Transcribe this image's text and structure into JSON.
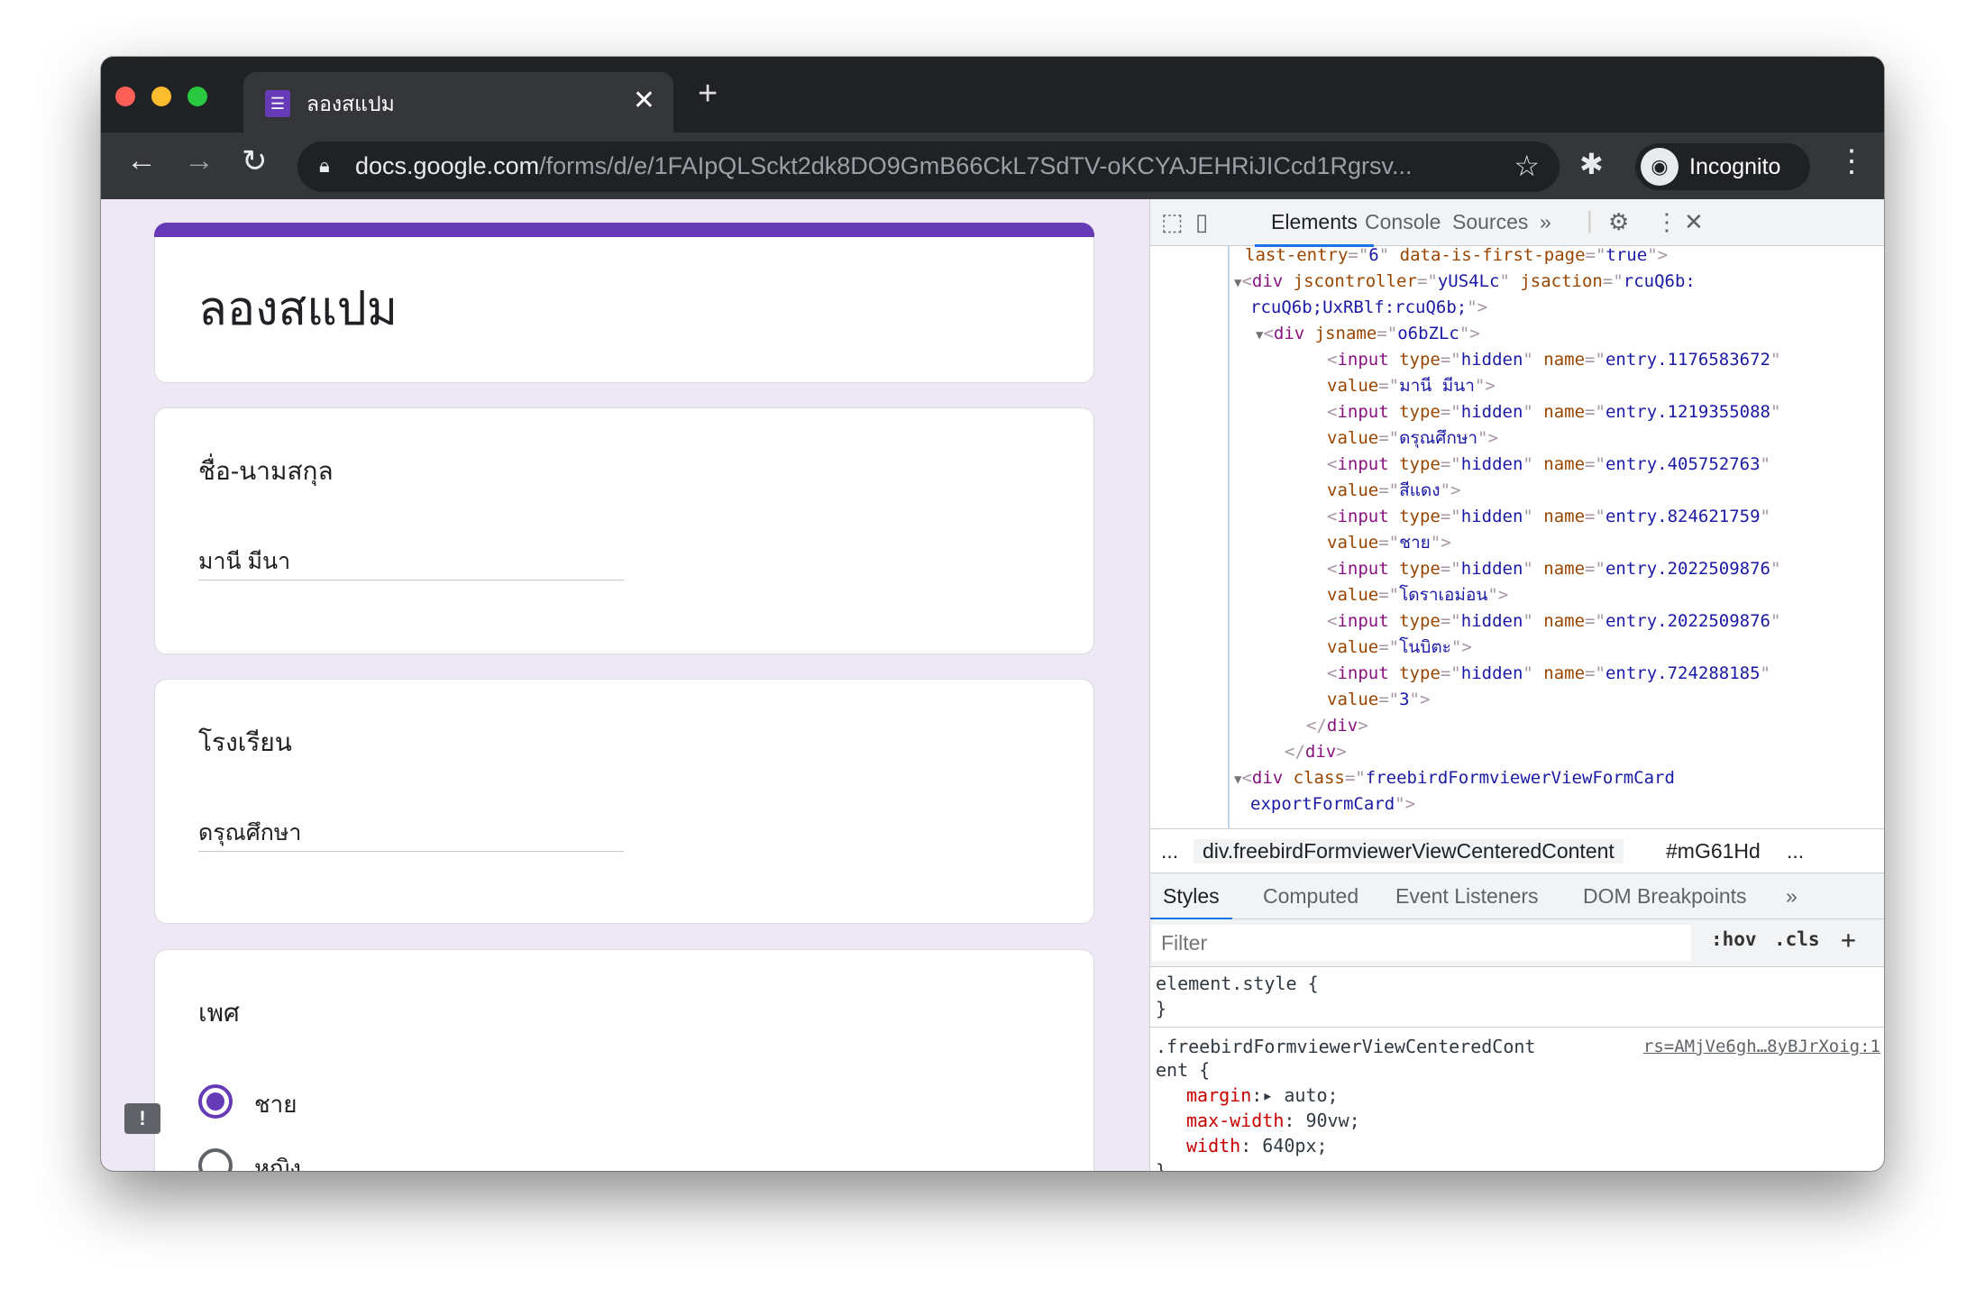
{
  "browser": {
    "tab_title": "ลองสแปม",
    "url_host": "docs.google.com",
    "url_path": "/forms/d/e/1FAIpQLSckt2dk8DO9GmB66CkL7SdTV-oKCYAJEHRiJICcd1Rgrsv...",
    "profile_label": "Incognito",
    "accent": "#673ab7"
  },
  "form": {
    "title": "ลองสแปม",
    "questions": [
      {
        "label": "ชื่อ-นามสกุล",
        "answer": "มานี มีนา"
      },
      {
        "label": "โรงเรียน",
        "answer": "ดรุณศึกษา"
      },
      {
        "label": "เพศ",
        "options": [
          {
            "label": "ชาย",
            "selected": true
          },
          {
            "label": "หญิง",
            "selected": false
          }
        ]
      }
    ]
  },
  "devtools": {
    "tabs": [
      "Elements",
      "Console",
      "Sources",
      "»"
    ],
    "active_tab": "Elements",
    "code_lines": [
      [
        [
          "an",
          "last-entry"
        ],
        [
          "pu",
          "=\""
        ],
        [
          "av",
          "6"
        ],
        [
          "pu",
          "\" "
        ],
        [
          "an",
          "data-is-first-page"
        ],
        [
          "pu",
          "=\""
        ],
        [
          "av",
          "true"
        ],
        [
          "pu",
          "\""
        ],
        [
          "br",
          ">"
        ]
      ],
      [
        [
          "tri",
          "▼"
        ],
        [
          "br",
          "<"
        ],
        [
          "tag",
          "div "
        ],
        [
          "an",
          "jscontroller"
        ],
        [
          "pu",
          "=\""
        ],
        [
          "av",
          "yUS4Lc"
        ],
        [
          "pu",
          "\" "
        ],
        [
          "an",
          "jsaction"
        ],
        [
          "pu",
          "=\""
        ],
        [
          "av",
          "rcuQ6b:"
        ]
      ],
      [
        [
          "av",
          "rcuQ6b;UxRBlf:rcuQ6b;"
        ],
        [
          "pu",
          "\""
        ],
        [
          "br",
          ">"
        ]
      ],
      [
        [
          "tri",
          "▼"
        ],
        [
          "br",
          "<"
        ],
        [
          "tag",
          "div "
        ],
        [
          "an",
          "jsname"
        ],
        [
          "pu",
          "=\""
        ],
        [
          "av",
          "o6bZLc"
        ],
        [
          "pu",
          "\""
        ],
        [
          "br",
          ">"
        ]
      ],
      [
        [
          "br",
          "<"
        ],
        [
          "tag",
          "input "
        ],
        [
          "an",
          "type"
        ],
        [
          "pu",
          "=\""
        ],
        [
          "av",
          "hidden"
        ],
        [
          "pu",
          "\" "
        ],
        [
          "an",
          "name"
        ],
        [
          "pu",
          "=\""
        ],
        [
          "av",
          "entry.1176583672"
        ],
        [
          "pu",
          "\""
        ]
      ],
      [
        [
          "an",
          "value"
        ],
        [
          "pu",
          "=\""
        ],
        [
          "av",
          "มานี มีนา"
        ],
        [
          "pu",
          "\""
        ],
        [
          "br",
          ">"
        ]
      ],
      [
        [
          "br",
          "<"
        ],
        [
          "tag",
          "input "
        ],
        [
          "an",
          "type"
        ],
        [
          "pu",
          "=\""
        ],
        [
          "av",
          "hidden"
        ],
        [
          "pu",
          "\" "
        ],
        [
          "an",
          "name"
        ],
        [
          "pu",
          "=\""
        ],
        [
          "av",
          "entry.1219355088"
        ],
        [
          "pu",
          "\""
        ]
      ],
      [
        [
          "an",
          "value"
        ],
        [
          "pu",
          "=\""
        ],
        [
          "av",
          "ดรุณศึกษา"
        ],
        [
          "pu",
          "\""
        ],
        [
          "br",
          ">"
        ]
      ],
      [
        [
          "br",
          "<"
        ],
        [
          "tag",
          "input "
        ],
        [
          "an",
          "type"
        ],
        [
          "pu",
          "=\""
        ],
        [
          "av",
          "hidden"
        ],
        [
          "pu",
          "\" "
        ],
        [
          "an",
          "name"
        ],
        [
          "pu",
          "=\""
        ],
        [
          "av",
          "entry.405752763"
        ],
        [
          "pu",
          "\""
        ]
      ],
      [
        [
          "an",
          "value"
        ],
        [
          "pu",
          "=\""
        ],
        [
          "av",
          "สีแดง"
        ],
        [
          "pu",
          "\""
        ],
        [
          "br",
          ">"
        ]
      ],
      [
        [
          "br",
          "<"
        ],
        [
          "tag",
          "input "
        ],
        [
          "an",
          "type"
        ],
        [
          "pu",
          "=\""
        ],
        [
          "av",
          "hidden"
        ],
        [
          "pu",
          "\" "
        ],
        [
          "an",
          "name"
        ],
        [
          "pu",
          "=\""
        ],
        [
          "av",
          "entry.824621759"
        ],
        [
          "pu",
          "\""
        ]
      ],
      [
        [
          "an",
          "value"
        ],
        [
          "pu",
          "=\""
        ],
        [
          "av",
          "ชาย"
        ],
        [
          "pu",
          "\""
        ],
        [
          "br",
          ">"
        ]
      ],
      [
        [
          "br",
          "<"
        ],
        [
          "tag",
          "input "
        ],
        [
          "an",
          "type"
        ],
        [
          "pu",
          "=\""
        ],
        [
          "av",
          "hidden"
        ],
        [
          "pu",
          "\" "
        ],
        [
          "an",
          "name"
        ],
        [
          "pu",
          "=\""
        ],
        [
          "av",
          "entry.2022509876"
        ],
        [
          "pu",
          "\""
        ]
      ],
      [
        [
          "an",
          "value"
        ],
        [
          "pu",
          "=\""
        ],
        [
          "av",
          "โดราเอม่อน"
        ],
        [
          "pu",
          "\""
        ],
        [
          "br",
          ">"
        ]
      ],
      [
        [
          "br",
          "<"
        ],
        [
          "tag",
          "input "
        ],
        [
          "an",
          "type"
        ],
        [
          "pu",
          "=\""
        ],
        [
          "av",
          "hidden"
        ],
        [
          "pu",
          "\" "
        ],
        [
          "an",
          "name"
        ],
        [
          "pu",
          "=\""
        ],
        [
          "av",
          "entry.2022509876"
        ],
        [
          "pu",
          "\""
        ]
      ],
      [
        [
          "an",
          "value"
        ],
        [
          "pu",
          "=\""
        ],
        [
          "av",
          "โนบิตะ"
        ],
        [
          "pu",
          "\""
        ],
        [
          "br",
          ">"
        ]
      ],
      [
        [
          "br",
          "<"
        ],
        [
          "tag",
          "input "
        ],
        [
          "an",
          "type"
        ],
        [
          "pu",
          "=\""
        ],
        [
          "av",
          "hidden"
        ],
        [
          "pu",
          "\" "
        ],
        [
          "an",
          "name"
        ],
        [
          "pu",
          "=\""
        ],
        [
          "av",
          "entry.724288185"
        ],
        [
          "pu",
          "\""
        ]
      ],
      [
        [
          "an",
          "value"
        ],
        [
          "pu",
          "=\""
        ],
        [
          "av",
          "3"
        ],
        [
          "pu",
          "\""
        ],
        [
          "br",
          ">"
        ]
      ],
      [
        [
          "br",
          "</"
        ],
        [
          "tag",
          "div"
        ],
        [
          "br",
          ">"
        ]
      ],
      [
        [
          "br",
          "</"
        ],
        [
          "tag",
          "div"
        ],
        [
          "br",
          ">"
        ]
      ],
      [
        [
          "tri",
          "▼"
        ],
        [
          "br",
          "<"
        ],
        [
          "tag",
          "div "
        ],
        [
          "an",
          "class"
        ],
        [
          "pu",
          "=\""
        ],
        [
          "av",
          "freebirdFormviewerViewFormCard"
        ]
      ],
      [
        [
          "av",
          "exportFormCard"
        ],
        [
          "pu",
          "\""
        ],
        [
          "br",
          ">"
        ]
      ]
    ],
    "breadcrumbs": [
      "...",
      "div.freebirdFormviewerViewCenteredContent",
      "#mG61Hd",
      "..."
    ],
    "style_tabs": [
      "Styles",
      "Computed",
      "Event Listeners",
      "DOM Breakpoints",
      "»"
    ],
    "filter_placeholder": "Filter",
    "hov": ":hov",
    "cls": ".cls",
    "add": "+",
    "element_style_open": "element.style {",
    "close_brace": "}",
    "rule_selector_1": ".freebirdFormviewerViewCenteredCont",
    "rule_selector_2": "ent {",
    "rule_source": "rs=AMjVe6gh…8yBJrXoig:1",
    "props": [
      {
        "name": "margin",
        "value": "▸ auto;"
      },
      {
        "name": "max-width",
        "value": " 90vw;"
      },
      {
        "name": "width",
        "value": " 640px;"
      }
    ]
  }
}
